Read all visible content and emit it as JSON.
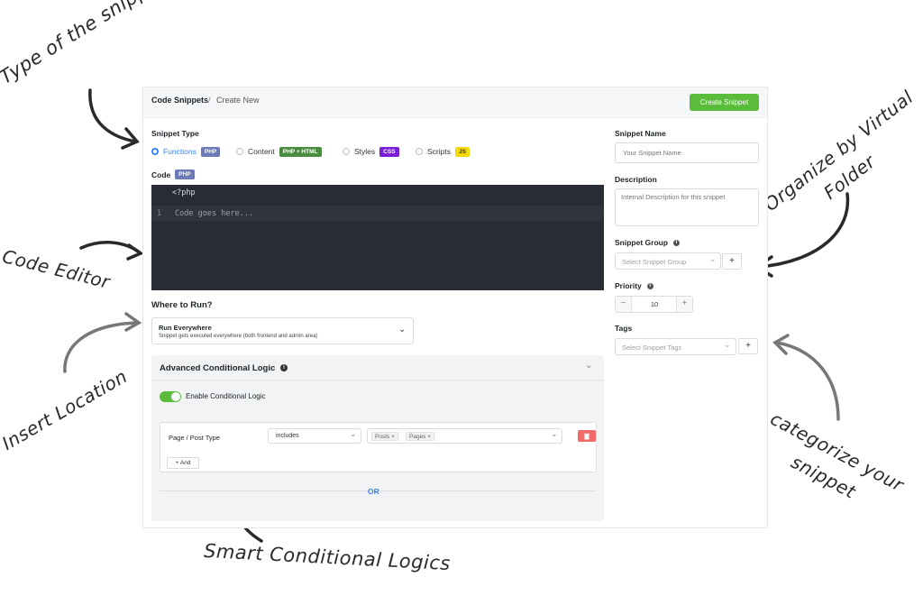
{
  "annotations": {
    "type": "Type of the snippet",
    "code_editor": "Code Editor",
    "insert_location": "Insert Location",
    "smart_logic": "Smart Conditional Logics",
    "organize_1": "Organize by Virtual",
    "organize_2": "Folder",
    "categorize_1": "categorize your",
    "categorize_2": "snippet"
  },
  "header": {
    "breadcrumb_root": "Code Snippets",
    "separator": "/",
    "breadcrumb_current": "Create New",
    "create_label": "Create Snippet"
  },
  "snippet_type": {
    "label": "Snippet Type",
    "options": [
      {
        "label": "Functions",
        "tag": "PHP",
        "tag_color": "#6c7ab8",
        "selected": true
      },
      {
        "label": "Content",
        "tag": "PHP + HTML",
        "tag_color": "#4a8c3f",
        "selected": false
      },
      {
        "label": "Styles",
        "tag": "CSS",
        "tag_color": "#7b1fd6",
        "selected": false
      },
      {
        "label": "Scripts",
        "tag": "JS",
        "tag_color": "#f5d90a",
        "selected": false
      }
    ]
  },
  "code": {
    "label": "Code",
    "tag": "PHP",
    "open_tag": "<?php",
    "line_number": "1",
    "placeholder": "Code goes here..."
  },
  "where_to_run": {
    "label": "Where to Run?",
    "selected_title": "Run Everywhere",
    "selected_sub": "Snippet gets executed everywhere (both frontend and admin area)"
  },
  "conditional": {
    "title": "Advanced Conditional Logic",
    "enable_label": "Enable Conditional Logic",
    "enabled": true,
    "rule_label": "Page / Post Type",
    "operator": "includes",
    "values": [
      "Posts",
      "Pages"
    ],
    "and_label": "+ And",
    "or_label": "OR"
  },
  "sidebar": {
    "name_label": "Snippet Name",
    "name_placeholder": "Your Snippet Name",
    "desc_label": "Description",
    "desc_placeholder": "Internal Description for this snippet",
    "group_label": "Snippet Group",
    "group_placeholder": "Select Snippet Group",
    "priority_label": "Priority",
    "priority_value": "10",
    "tags_label": "Tags",
    "tags_placeholder": "Select Snippet Tags"
  }
}
